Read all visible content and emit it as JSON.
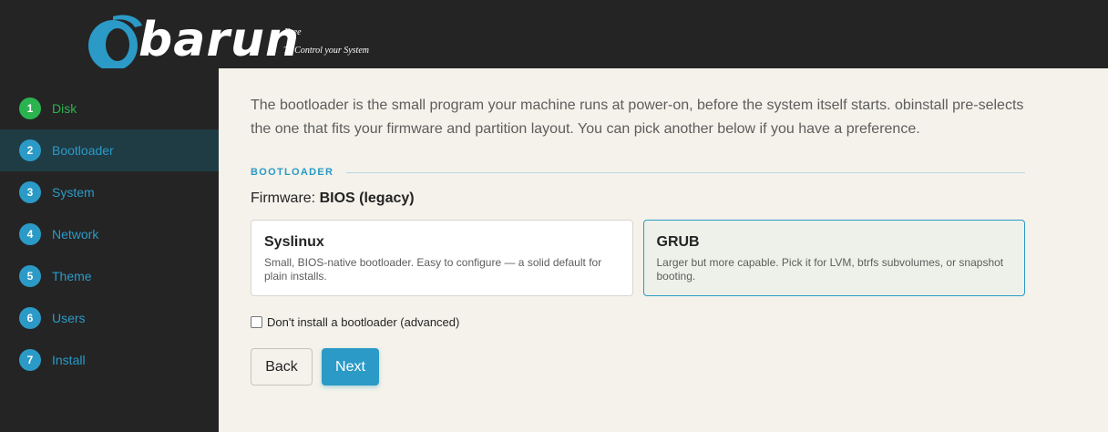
{
  "header": {
    "logo_text": "barun",
    "tagline_line1": "Free",
    "tagline_line2": "To Control your System"
  },
  "sidebar": {
    "steps": [
      {
        "number": "1",
        "label": "Disk",
        "state": "done"
      },
      {
        "number": "2",
        "label": "Bootloader",
        "state": "active"
      },
      {
        "number": "3",
        "label": "System",
        "state": "pending"
      },
      {
        "number": "4",
        "label": "Network",
        "state": "pending"
      },
      {
        "number": "5",
        "label": "Theme",
        "state": "pending"
      },
      {
        "number": "6",
        "label": "Users",
        "state": "pending"
      },
      {
        "number": "7",
        "label": "Install",
        "state": "pending"
      }
    ]
  },
  "main": {
    "intro": "The bootloader is the small program your machine runs at power-on, before the system itself starts. obinstall pre-selects the one that fits your firmware and partition layout. You can pick another below if you have a preference.",
    "section_title": "BOOTLOADER",
    "firmware_label": "Firmware:",
    "firmware_value": "BIOS (legacy)",
    "options": [
      {
        "title": "Syslinux",
        "description": "Small, BIOS-native bootloader. Easy to configure — a solid default for plain installs.",
        "selected": false
      },
      {
        "title": "GRUB",
        "description": "Larger but more capable. Pick it for LVM, btrfs subvolumes, or snapshot booting.",
        "selected": true
      }
    ],
    "skip_label": "Don't install a bootloader (advanced)",
    "skip_checked": false,
    "back_label": "Back",
    "next_label": "Next"
  },
  "colors": {
    "accent": "#2b9ac7",
    "done": "#2bb34f",
    "header_bg": "#242424",
    "active_row_bg": "#1f3b44",
    "content_bg": "#f4f2ea"
  }
}
